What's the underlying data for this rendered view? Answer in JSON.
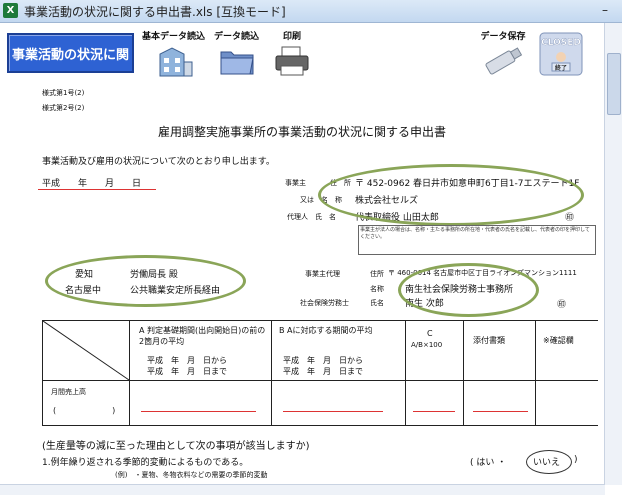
{
  "window": {
    "title": "事業活動の状況に関する申出書.xls [互換モード]",
    "minimize": "–"
  },
  "toolbar": {
    "main_button": "事業活動の状況に関",
    "basic_data": "基本データ読込",
    "data_load": "データ読込",
    "print": "印刷",
    "save": "データ保存",
    "closed_top": "CLOSED",
    "closed_bottom": "終了"
  },
  "form": {
    "form_no1": "様式第1号(2)",
    "form_no2": "様式第2号(2)",
    "title": "雇用調整実施事業所の事業活動の状況に関する申出書",
    "intro": "事業活動及び雇用の状況について次のとおり申し出ます。",
    "date": "平成　　年　　月　　日",
    "employer_label": "事業主",
    "address_label": "住　所",
    "address_value": "〒 452-0962 春日井市如意申町6丁目1-7エステート1F",
    "name_label": "又は　名　称",
    "name_value": "株式会社セルズ",
    "rep_label": "代理人　氏　名",
    "rep_value": "代表取締役 山田太郎",
    "seal": "㊞",
    "note": "事業主が法人の場合は、名称・主たる事務所の所在地・代表者の氏名を記載し、代表者の印を押印してください。",
    "to_aichi": "愛知",
    "to_labor": "労働局長 殿",
    "to_nagoya": "名古屋中",
    "to_office": "公共職業安定所長経由",
    "agent_label": "事業主代理",
    "agent_address_label": "住所",
    "agent_address": "〒 460-0014 名古屋市中区丁目ライオンズマンション1111",
    "agent_name_label": "名称",
    "agent_name": "南生社会保険労務士事務所",
    "sharoushi_label": "社会保険労務士",
    "sharoushi_name_label": "氏名",
    "sharoushi_name": "南生 次郎",
    "col_a": "A 判定基礎期間(出向開始日)の前の2箇月の平均",
    "col_a_from": "平成　年　月　日から",
    "col_a_to": "平成　年　月　日まで",
    "col_b": "B Aに対応する期間の平均",
    "col_b_from": "平成　年　月　日から",
    "col_b_to": "平成　年　月　日まで",
    "col_c": "C",
    "col_c_formula": "A/B×100",
    "col_d": "添付書類",
    "col_e": "※確認欄",
    "row_label": "月間売上高",
    "row_paren": "(　　　　　　　)",
    "question": "(生産量等の減に至った理由として次の事項が該当しますか)",
    "q1": "1.例年繰り返される季節的変動によるものである。",
    "q1_sub": "(例)　・夏物、冬物衣料などの需要の季節的変動",
    "yes": "はい",
    "dot": "・",
    "no": "いいえ"
  }
}
